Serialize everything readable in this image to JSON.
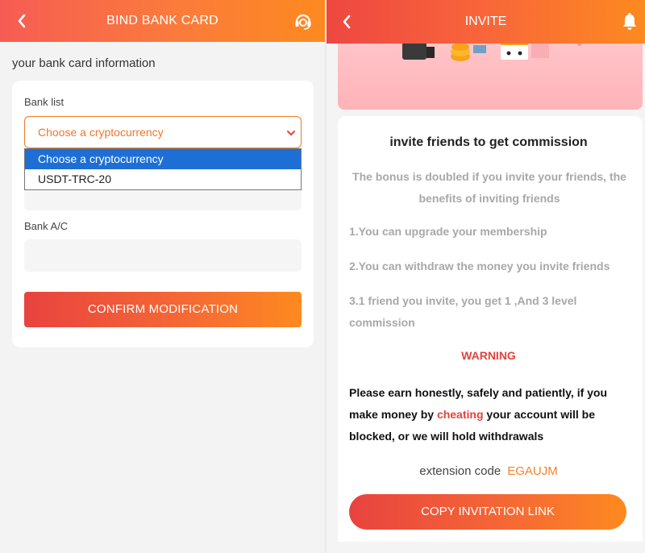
{
  "left": {
    "title": "BIND BANK CARD",
    "subtitle": "your bank card information",
    "bank_list_label": "Bank list",
    "select": {
      "value": "Choose a cryptocurrency",
      "options": [
        "Choose a cryptocurrency",
        "USDT-TRC-20"
      ],
      "selected_index": 0
    },
    "account_label": "Bank A/C",
    "confirm_label": "CONFIRM MODIFICATION"
  },
  "right": {
    "title": "INVITE",
    "heading": "invite friends to get commission",
    "bonus": "The bonus is doubled if you invite your friends, the benefits of inviting friends",
    "points": [
      "1.You can upgrade your membership",
      "2.You can withdraw the money you invite friends",
      "3.1 friend you invite, you get 1 ,And 3 level commission"
    ],
    "warning": "WARNING",
    "note_before": "Please earn honestly, safely and patiently, if you make money by ",
    "note_highlight": "cheating",
    "note_after": " your account will be blocked, or we will hold withdrawals",
    "extension_label": "extension code",
    "extension_code": "EGAUJM",
    "copy_label": "COPY INVITATION LINK"
  },
  "colors": {
    "accent": "#fd8a1f",
    "accent_red": "#e8433f",
    "warning_red": "#e2433c",
    "select_blue": "#1e6fd5"
  },
  "icons": {
    "back": "chevron-left-icon",
    "support": "headset-icon",
    "bell": "bell-icon",
    "select_arrow": "chevron-down-icon"
  }
}
